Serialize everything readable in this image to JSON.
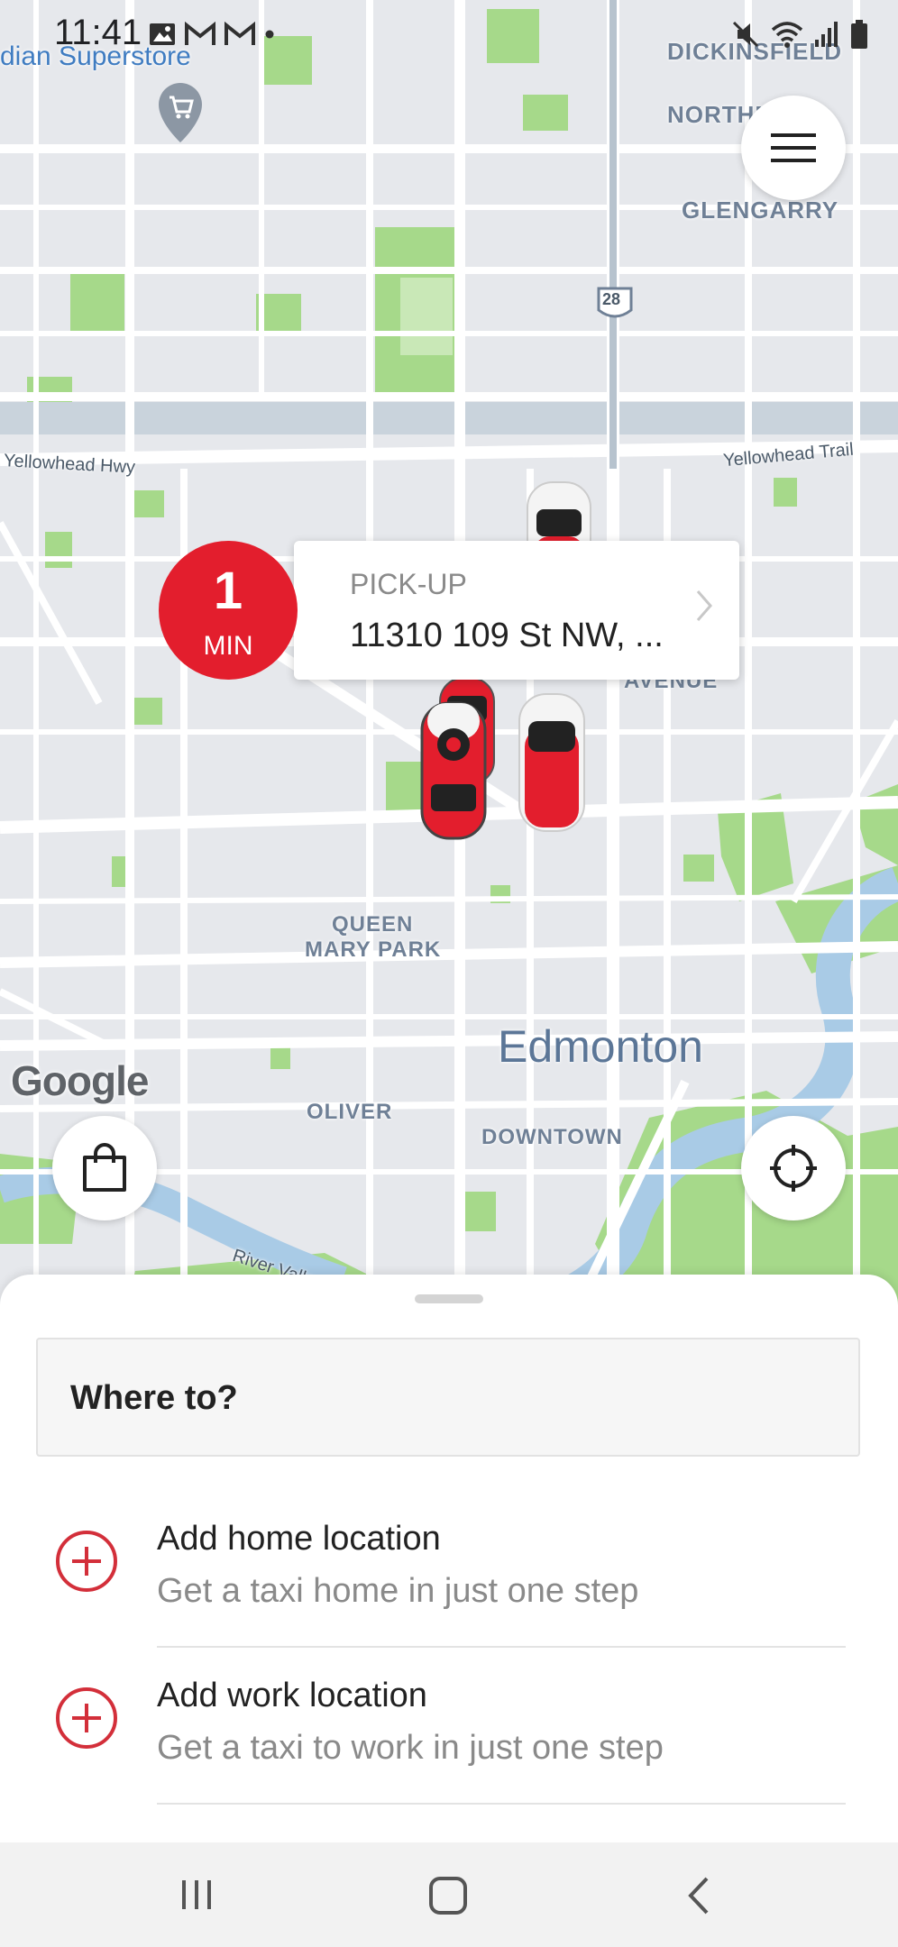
{
  "status_bar": {
    "time": "11:41",
    "left_icons": [
      "image-icon",
      "gmail-icon",
      "gmail-icon",
      "dot-icon"
    ],
    "right_icons": [
      "mute-icon",
      "wifi-icon",
      "signal-icon",
      "battery-icon"
    ]
  },
  "map": {
    "labels": {
      "superstore": "dian Superstore",
      "dickinsfield": "DICKINSFIELD",
      "northmount": "NORTHM",
      "glengarry": "GLENGARRY",
      "highway_28": "28",
      "yellowhead_hwy": "Yellowhead Hwy",
      "yellowhead_trail": "Yellowhead Trail",
      "avenue": "AVENUE",
      "queen_mary_park_1": "QUEEN",
      "queen_mary_park_2": "MARY PARK",
      "edmonton": "Edmonton",
      "oliver": "OLIVER",
      "downtown": "DOWNTOWN",
      "river_valley": "River Valley Rd NW",
      "google": "Google"
    },
    "colors": {
      "land": "#e6e8ec",
      "road": "#ffffff",
      "park": "#a6d98a",
      "water": "#a9cbe6"
    }
  },
  "pickup": {
    "eta_value": "1",
    "eta_unit": "MIN",
    "label": "PICK-UP",
    "address": "11310 109 St NW, ..."
  },
  "sheet": {
    "search_placeholder": "Where to?",
    "items": [
      {
        "title": "Add home location",
        "subtitle": "Get a taxi home in just one step"
      },
      {
        "title": "Add work location",
        "subtitle": "Get a taxi to work in just one step"
      }
    ]
  },
  "colors": {
    "accent": "#e31e2d",
    "icon_red": "#d32f3a"
  }
}
